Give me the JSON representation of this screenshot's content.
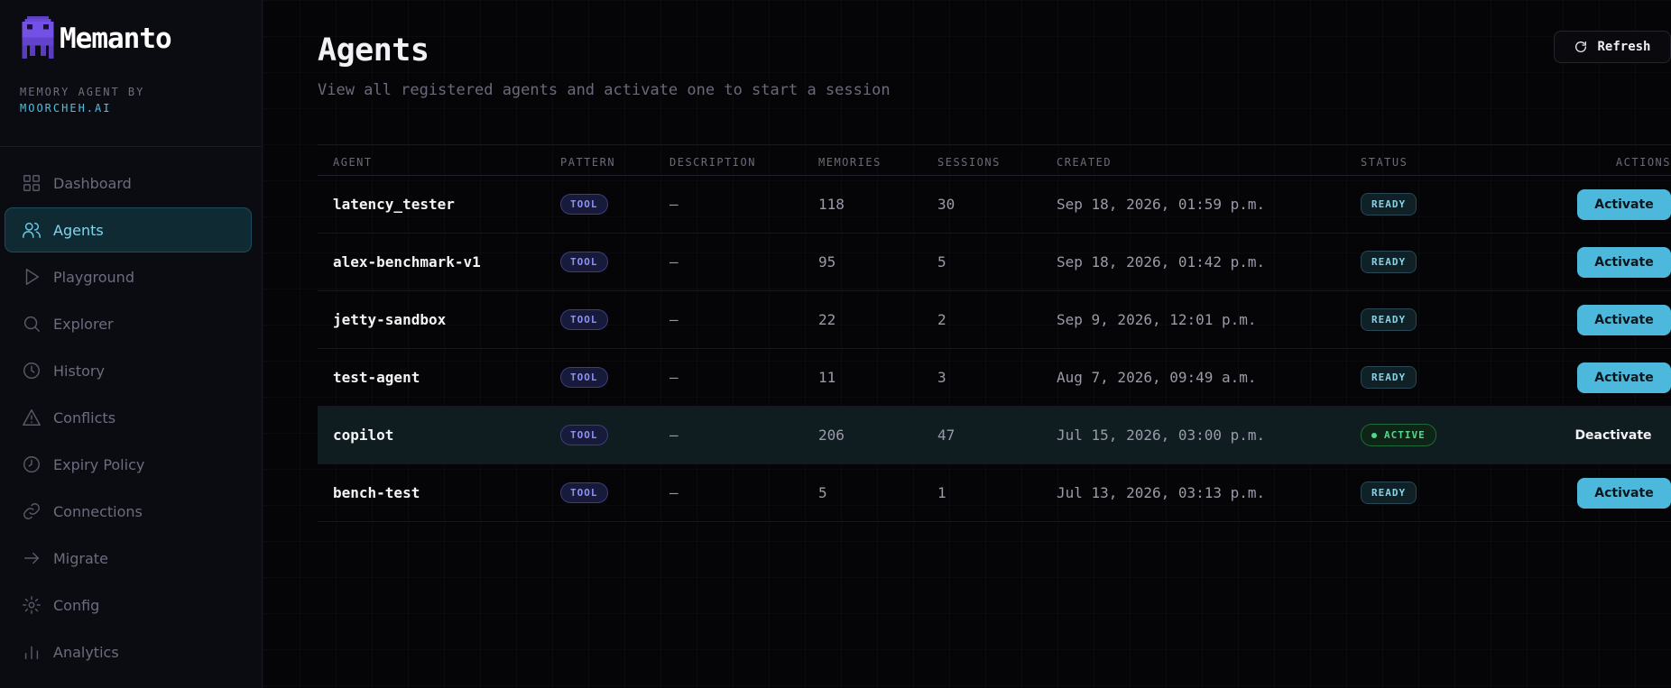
{
  "brand": {
    "name": "Memanto",
    "tagline_line1": "MEMORY AGENT BY",
    "tagline_line2": "MOORCHEH.AI",
    "logo_icon": "pixel-octopus-icon"
  },
  "sidebar": {
    "items": [
      {
        "label": "Dashboard",
        "icon": "grid-icon",
        "active": false
      },
      {
        "label": "Agents",
        "icon": "users-icon",
        "active": true
      },
      {
        "label": "Playground",
        "icon": "play-icon",
        "active": false
      },
      {
        "label": "Explorer",
        "icon": "search-icon",
        "active": false
      },
      {
        "label": "History",
        "icon": "clock-icon",
        "active": false
      },
      {
        "label": "Conflicts",
        "icon": "warning-icon",
        "active": false
      },
      {
        "label": "Expiry Policy",
        "icon": "expiry-clock-icon",
        "active": false
      },
      {
        "label": "Connections",
        "icon": "link-icon",
        "active": false
      },
      {
        "label": "Migrate",
        "icon": "arrow-right-icon",
        "active": false
      },
      {
        "label": "Config",
        "icon": "gear-icon",
        "active": false
      },
      {
        "label": "Analytics",
        "icon": "bar-chart-icon",
        "active": false
      }
    ]
  },
  "header": {
    "title": "Agents",
    "subtitle": "View all registered agents and activate one to start a session",
    "refresh_label": "Refresh"
  },
  "table": {
    "columns": [
      "AGENT",
      "PATTERN",
      "DESCRIPTION",
      "MEMORIES",
      "SESSIONS",
      "CREATED",
      "STATUS",
      "ACTIONS"
    ],
    "rows": [
      {
        "agent": "latency_tester",
        "pattern": "TOOL",
        "description": "—",
        "memories": "118",
        "sessions": "30",
        "created": "Sep 18, 2026, 01:59 p.m.",
        "status": "READY",
        "action": "Activate"
      },
      {
        "agent": "alex-benchmark-v1",
        "pattern": "TOOL",
        "description": "—",
        "memories": "95",
        "sessions": "5",
        "created": "Sep 18, 2026, 01:42 p.m.",
        "status": "READY",
        "action": "Activate"
      },
      {
        "agent": "jetty-sandbox",
        "pattern": "TOOL",
        "description": "—",
        "memories": "22",
        "sessions": "2",
        "created": "Sep 9, 2026, 12:01 p.m.",
        "status": "READY",
        "action": "Activate"
      },
      {
        "agent": "test-agent",
        "pattern": "TOOL",
        "description": "—",
        "memories": "11",
        "sessions": "3",
        "created": "Aug 7, 2026, 09:49 a.m.",
        "status": "READY",
        "action": "Activate"
      },
      {
        "agent": "copilot",
        "pattern": "TOOL",
        "description": "—",
        "memories": "206",
        "sessions": "47",
        "created": "Jul 15, 2026, 03:00 p.m.",
        "status": "ACTIVE",
        "action": "Deactivate"
      },
      {
        "agent": "bench-test",
        "pattern": "TOOL",
        "description": "—",
        "memories": "5",
        "sessions": "1",
        "created": "Jul 13, 2026, 03:13 p.m.",
        "status": "READY",
        "action": "Activate"
      }
    ]
  },
  "colors": {
    "accent": "#4cb8dc",
    "active_status": "#52d88a",
    "tool_tag": "#8e92ec",
    "background": "#050507"
  }
}
